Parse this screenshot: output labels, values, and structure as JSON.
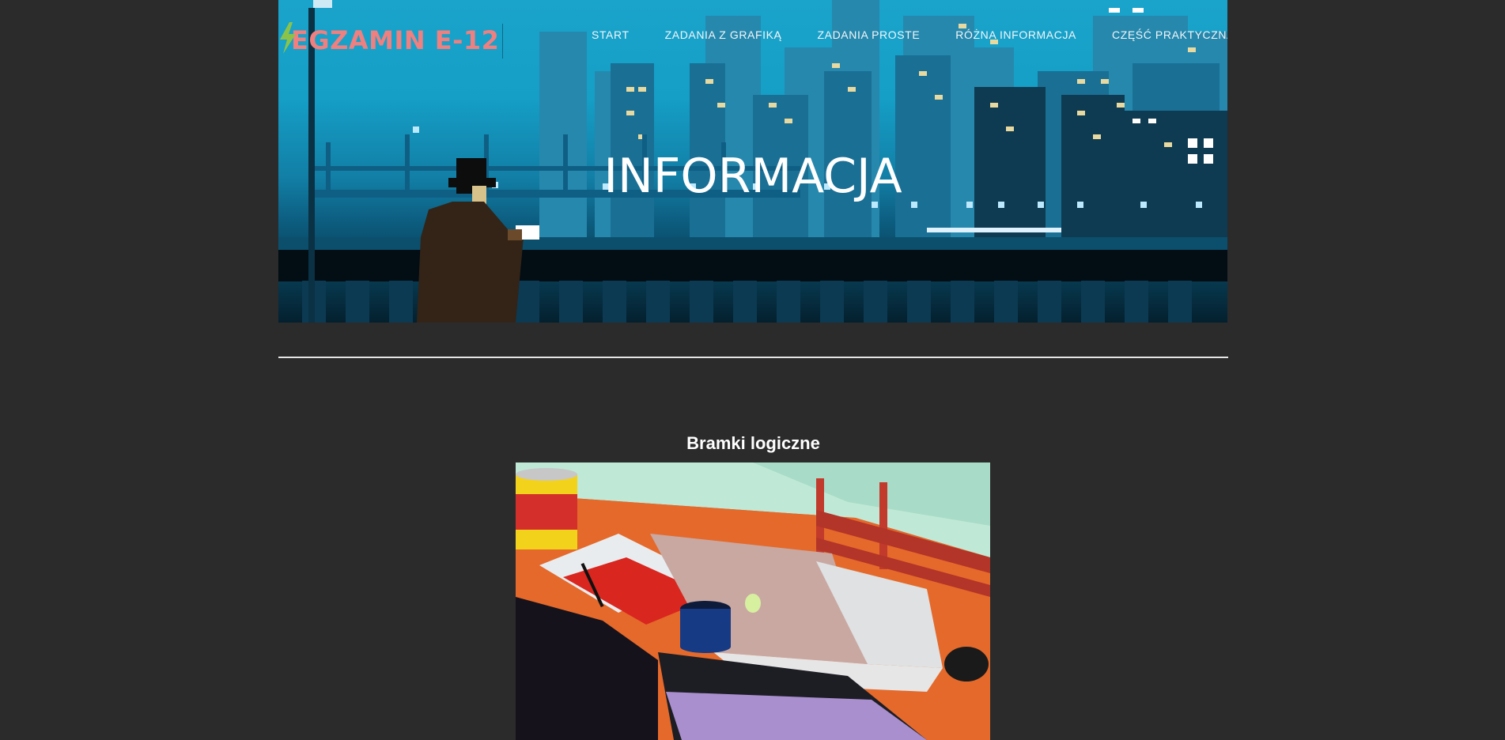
{
  "header": {
    "logo_text": "EGZAMIN E-12",
    "nav": [
      {
        "label": "START"
      },
      {
        "label": "ZADANIA Z GRAFIKĄ"
      },
      {
        "label": "ZADANIA PROSTE"
      },
      {
        "label": "RÓŻNA INFORMACJA"
      },
      {
        "label": "CZĘŚĆ PRAKTYCZNA"
      }
    ]
  },
  "hero": {
    "title": "INFORMACJA"
  },
  "main": {
    "section_title": "Bramki logiczne"
  },
  "colors": {
    "page_background": "#2b2b2b",
    "logo_text": "#f07f7f",
    "bolt": "#8bc34a",
    "sky": "#1aa3cb",
    "rule": "#e6e6e6"
  },
  "icons": {
    "logo": "lightning-bolt-icon"
  }
}
